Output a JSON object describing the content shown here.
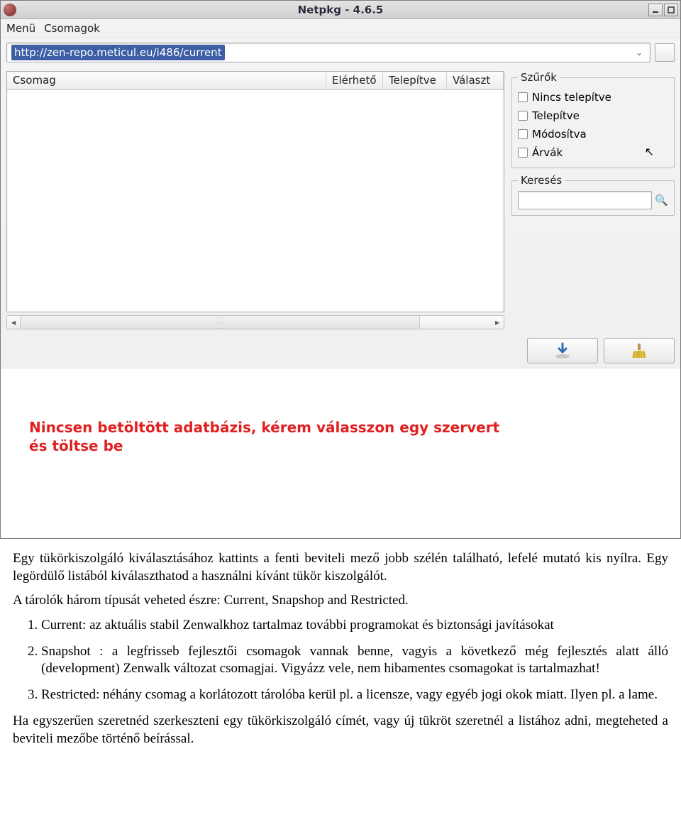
{
  "window": {
    "title": "Netpkg - 4.6.5"
  },
  "menubar": {
    "menu": "Menü",
    "csomagok": "Csomagok"
  },
  "url": "http://zen-repo.meticul.eu/i486/current",
  "columns": {
    "csomag": "Csomag",
    "elerheto": "Elérhető",
    "telepitve": "Telepítve",
    "valaszt": "Választ"
  },
  "filters": {
    "legend": "Szűrők",
    "nincs_telepitve": "Nincs telepítve",
    "telepitve": "Telepítve",
    "modositva": "Módosítva",
    "arvak": "Árvák"
  },
  "search": {
    "legend": "Keresés"
  },
  "message": "Nincsen betöltött adatbázis, kérem válasszon egy szervert és töltse be",
  "doc": {
    "p1": "Egy tükörkiszolgáló kiválasztásához kattints a fenti beviteli mező jobb szélén található, lefelé mutató kis nyílra. Egy legördülő listából kiválaszthatod a használni kívánt tükör kiszolgálót.",
    "p2": "A tárolók három típusát veheted észre: Current, Snapshop and Restricted.",
    "li1": "Current: az aktuális stabil Zenwalkhoz tartalmaz további programokat és biztonsági javításokat",
    "li2": "Snapshot : a legfrisseb fejlesztői csomagok vannak benne, vagyis a következő még fejlesztés alatt álló (development) Zenwalk változat csomagjai. Vigyázz vele, nem hibamentes csomagokat is tartalmazhat!",
    "li3": "Restricted: néhány csomag a korlátozott tárolóba kerül pl. a licensze, vagy egyéb jogi okok miatt. Ilyen pl. a lame.",
    "p3": "Ha egyszerűen szeretnéd szerkeszteni egy tükörkiszolgáló címét, vagy új tükröt szeretnél a listához adni, megteheted a beviteli mezőbe történő beírással."
  }
}
